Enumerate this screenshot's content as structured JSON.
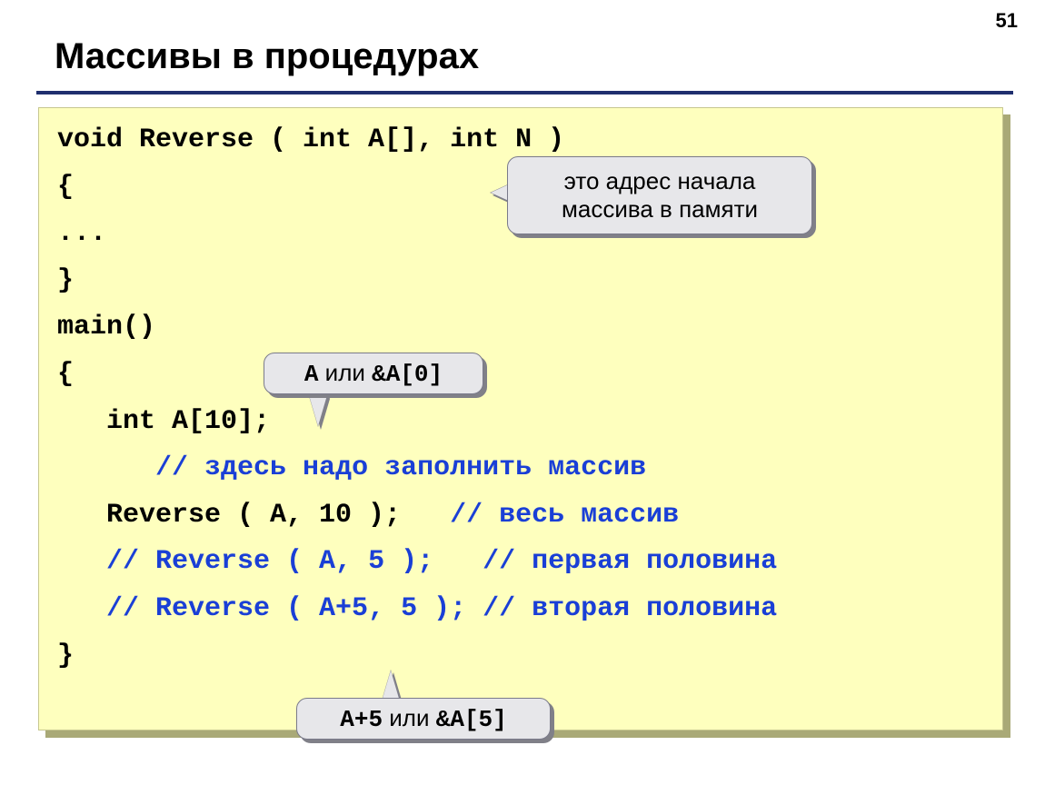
{
  "page_number": "51",
  "title": "Массивы в процедурах",
  "code": {
    "l1": "void Reverse ( int A[], int N )",
    "l2": "{",
    "l3": "...",
    "l4": "}",
    "l5": "main()",
    "l6": "{",
    "l7": "   int A[10];",
    "l8a": "      ",
    "l8b": "// здесь надо заполнить массив",
    "l9a": "   Reverse ( A, 10 );   ",
    "l9b": "// весь массив",
    "l10a": "   ",
    "l10b": "// Reverse ( A, 5 );   // первая половина",
    "l11a": "   ",
    "l11b": "// Reverse ( A+5, 5 ); // вторая половина",
    "l12": "}"
  },
  "callouts": {
    "c1": "это адрес начала массива в памяти",
    "c2_pre": "A",
    "c2_mid": " или ",
    "c2_post": "&A[0]",
    "c3_pre": "A+5",
    "c3_mid": " или ",
    "c3_post": "&A[5]"
  }
}
